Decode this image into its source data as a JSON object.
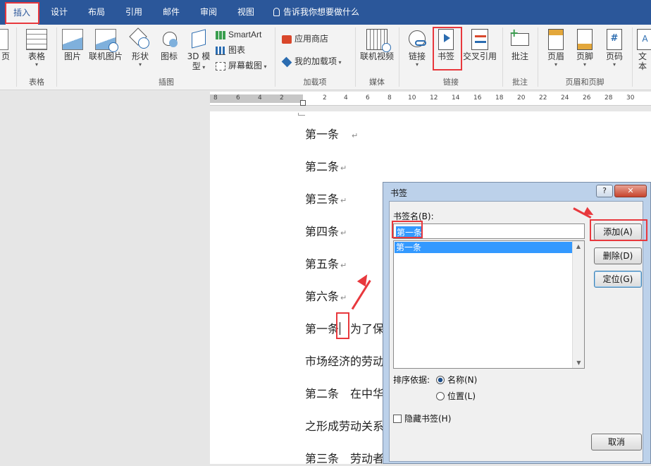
{
  "tabs": [
    {
      "label": "插入",
      "active": true
    },
    {
      "label": "设计"
    },
    {
      "label": "布局"
    },
    {
      "label": "引用"
    },
    {
      "label": "邮件"
    },
    {
      "label": "审阅"
    },
    {
      "label": "视图"
    }
  ],
  "tell_me": "告诉我你想要做什么",
  "ribbon": {
    "pages_partial": "页",
    "table": "表格",
    "picture": "图片",
    "online_picture": "联机图片",
    "shapes": "形状",
    "icons": "图标",
    "model3d_1": "3D 模",
    "model3d_2": "型",
    "smartart": "SmartArt",
    "chart": "图表",
    "screenshot": "屏幕截图",
    "store": "应用商店",
    "my_addins": "我的加载项",
    "online_video": "联机视频",
    "link": "链接",
    "bookmark": "书签",
    "cross_ref": "交叉引用",
    "comment": "批注",
    "header": "页眉",
    "footer": "页脚",
    "page_number": "页码",
    "text_partial": "文本",
    "groups": {
      "table": "表格",
      "illustrations": "插图",
      "addins": "加载项",
      "media": "媒体",
      "links": "链接",
      "comments": "批注",
      "header_footer": "页眉和页脚"
    }
  },
  "ruler": [
    "8",
    "6",
    "4",
    "2",
    "2",
    "4",
    "6",
    "8",
    "10",
    "12",
    "14",
    "16",
    "18",
    "20",
    "22",
    "24",
    "26",
    "28",
    "30"
  ],
  "document": {
    "lines": [
      "第一条",
      "第二条",
      "第三条",
      "第四条",
      "第五条",
      "第六条",
      "第一条",
      "为了保",
      "市场经济的劳动",
      "第二条　在中华",
      "之形成劳动关系",
      "第三条　劳动者"
    ]
  },
  "dialog": {
    "title": "书签",
    "help": "?",
    "close": "✕",
    "name_label": "书签名(B):",
    "name_value": "第一条",
    "list_items": [
      "第一条"
    ],
    "add": "添加(A)",
    "delete": "删除(D)",
    "goto": "定位(G)",
    "sort_label": "排序依据:",
    "sort_name": "名称(N)",
    "sort_location": "位置(L)",
    "hidden": "隐藏书签(H)",
    "cancel": "取消"
  }
}
